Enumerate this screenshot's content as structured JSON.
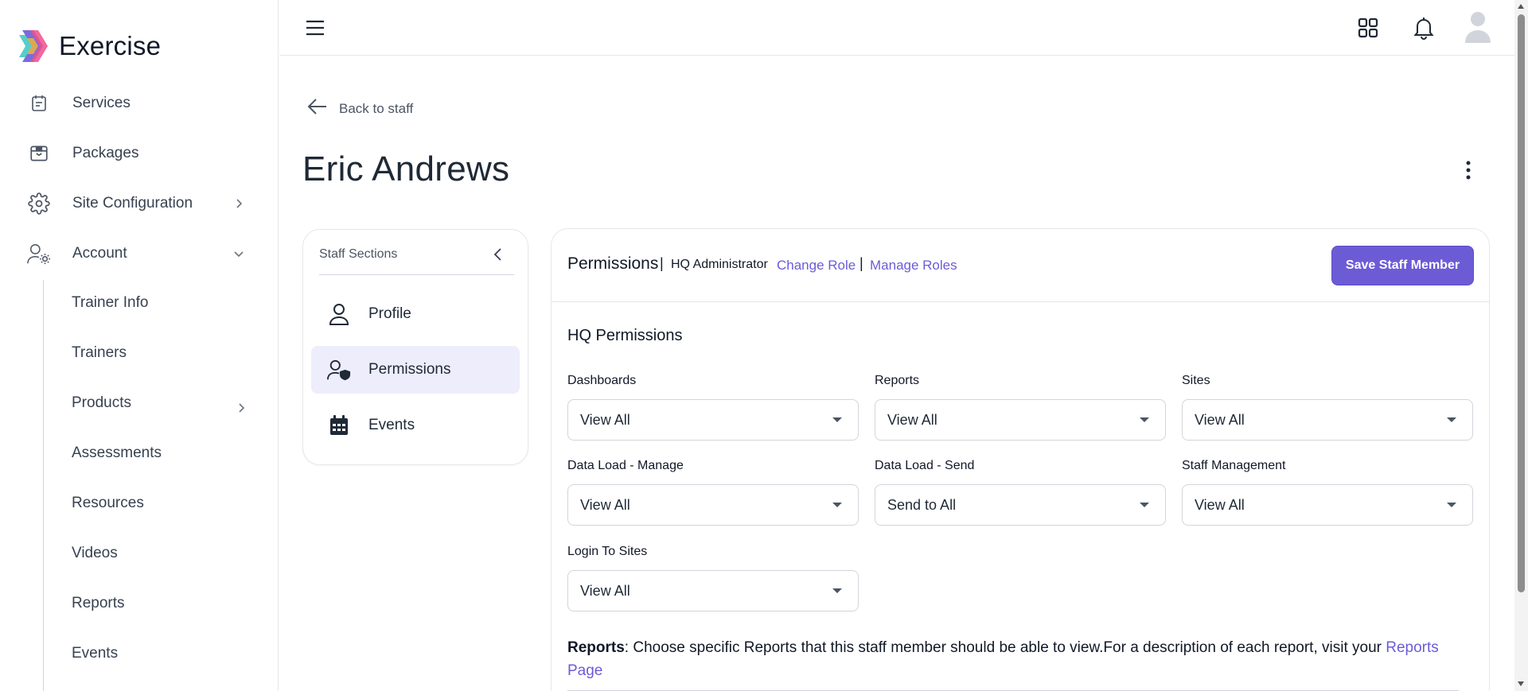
{
  "app": {
    "name": "Exercise"
  },
  "sidebar": {
    "items": [
      {
        "label": "Services",
        "icon": "calendar-check-icon"
      },
      {
        "label": "Packages",
        "icon": "package-icon"
      },
      {
        "label": "Site Configuration",
        "icon": "gear-icon",
        "expandable": true
      },
      {
        "label": "Account",
        "icon": "user-settings-icon",
        "expanded": true
      }
    ],
    "sub_items": [
      {
        "label": "Trainer Info"
      },
      {
        "label": "Trainers"
      },
      {
        "label": "Products",
        "expandable": true
      },
      {
        "label": "Assessments"
      },
      {
        "label": "Resources"
      },
      {
        "label": "Videos"
      },
      {
        "label": "Reports"
      },
      {
        "label": "Events"
      }
    ]
  },
  "topbar": {
    "icons": [
      "menu-icon",
      "apps-grid-icon",
      "bell-icon",
      "avatar-icon"
    ]
  },
  "page": {
    "back_label": "Back to staff",
    "title": "Eric Andrews"
  },
  "staff_sections": {
    "header": "Staff Sections",
    "items": [
      {
        "label": "Profile",
        "icon": "user-icon",
        "active": false
      },
      {
        "label": "Permissions",
        "icon": "user-shield-icon",
        "active": true
      },
      {
        "label": "Events",
        "icon": "calendar-icon",
        "active": false
      }
    ]
  },
  "permissions": {
    "title": "Permissions",
    "separator": "|",
    "role": "HQ Administrator",
    "change_role": "Change Role",
    "manage_roles": "Manage Roles",
    "save_label": "Save Staff Member",
    "hq_title": "HQ Permissions",
    "fields": [
      {
        "label": "Dashboards",
        "value": "View All"
      },
      {
        "label": "Reports",
        "value": "View All"
      },
      {
        "label": "Sites",
        "value": "View All"
      },
      {
        "label": "Data Load - Manage",
        "value": "View All"
      },
      {
        "label": "Data Load - Send",
        "value": "Send to All"
      },
      {
        "label": "Staff Management",
        "value": "View All"
      },
      {
        "label": "Login To Sites",
        "value": "View All"
      }
    ],
    "reports_note": {
      "bold": "Reports",
      "text": ": Choose specific Reports that this staff member should be able to view.For a description of each report, visit your ",
      "link": "Reports Page"
    }
  },
  "colors": {
    "accent": "#6b5cd6",
    "active_bg": "#eeedfb",
    "text": "#1f2937",
    "border": "#e5e7eb"
  }
}
